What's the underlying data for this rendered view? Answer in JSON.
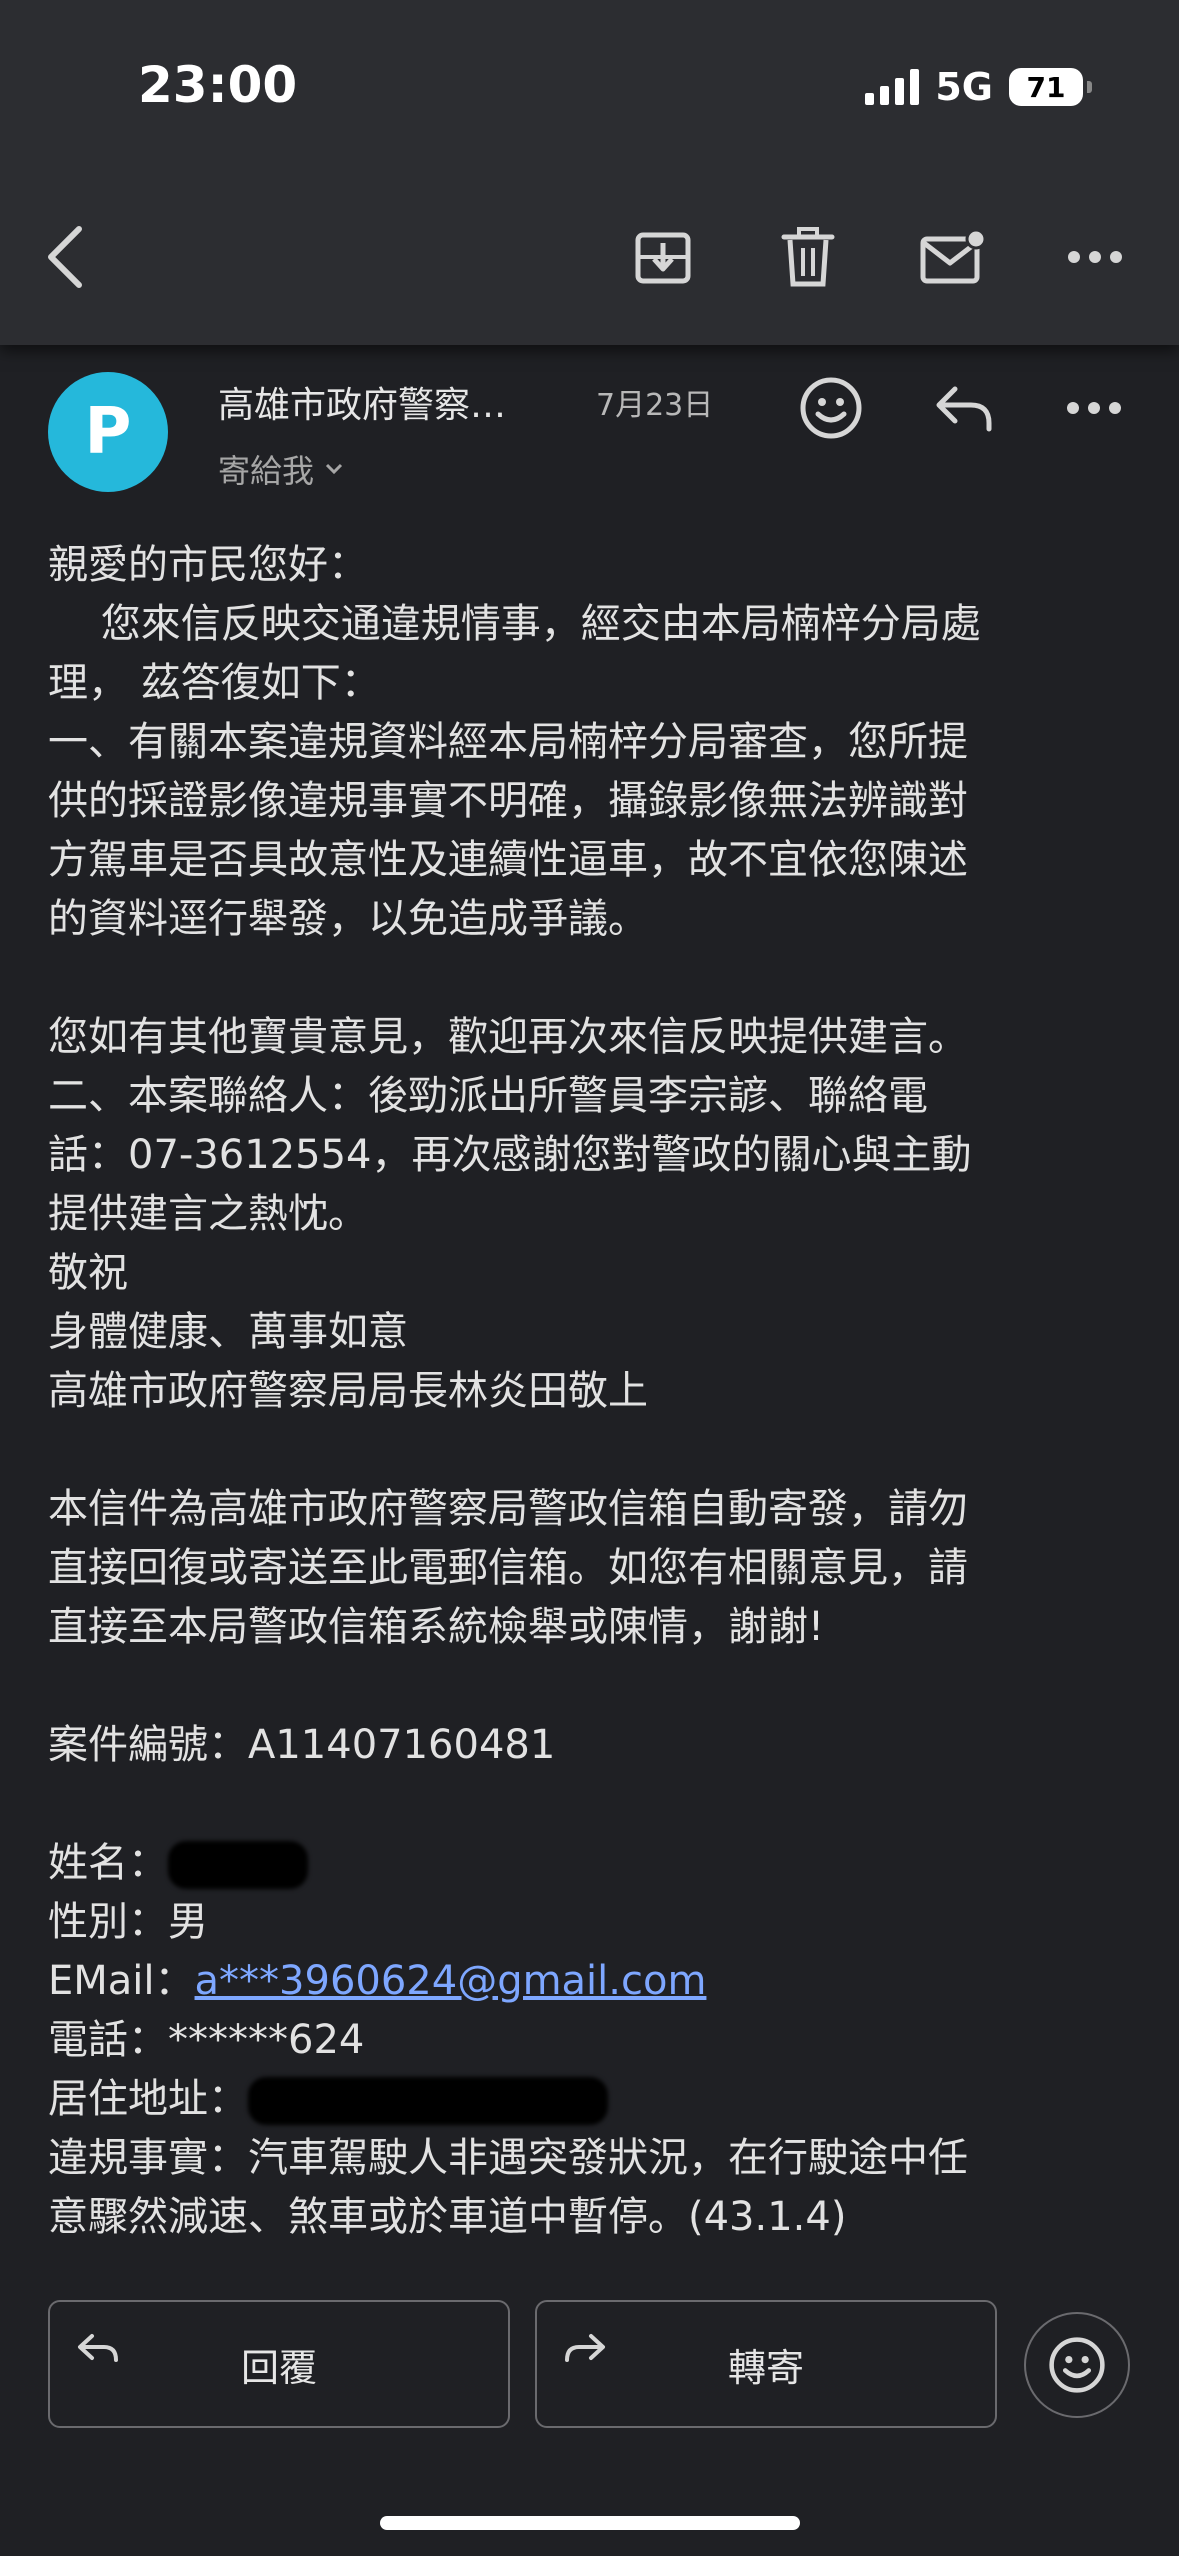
{
  "status_bar": {
    "time": "23:00",
    "network": "5G",
    "battery": "71"
  },
  "toolbar": {
    "back_icon": "chevron-left-icon",
    "archive_icon": "archive-icon",
    "delete_icon": "trash-icon",
    "unread_icon": "mail-unread-icon",
    "more_icon": "more-horizontal-icon"
  },
  "message": {
    "avatar_letter": "P",
    "sender": "高雄市政府警察…",
    "date": "7月23日",
    "recipient": "寄給我",
    "body_lines": [
      "親愛的市民您好：",
      "　 您來信反映交通違規情事，經交由本局楠梓分局處",
      "理， 茲答復如下：",
      "一、有關本案違規資料經本局楠梓分局審查，您所提",
      "供的採證影像違規事實不明確，攝錄影像無法辨識對",
      "方駕車是否具故意性及連續性逼車，故不宜依您陳述",
      "的資料逕行舉發，以免造成爭議。",
      "",
      "您如有其他寶貴意見，歡迎再次來信反映提供建言。",
      "二、本案聯絡人：後勁派出所警員李宗諺、聯絡電",
      "話：07-3612554，再次感謝您對警政的關心與主動",
      "提供建言之熱忱。",
      "敬祝",
      "身體健康、萬事如意",
      "高雄市政府警察局局長林炎田敬上",
      "",
      "本信件為高雄市政府警察局警政信箱自動寄發，請勿",
      "直接回復或寄送至此電郵信箱。如您有相關意見，請",
      "直接至本局警政信箱系統檢舉或陳情，謝謝!"
    ],
    "case_number": "案件編號：A11407160481",
    "name_label": "姓名：",
    "gender": "性別：男",
    "email_label": "EMail：",
    "email_value": "a***3960624@gmail.com",
    "phone": "電話：******624",
    "address_label": "居住地址：",
    "violation_lines": [
      "違規事實：汽車駕駛人非遇突發狀況，在行駛途中任",
      "意驟然減速、煞車或於車道中暫停。(43.1.4)"
    ]
  },
  "actions": {
    "reply": "回覆",
    "forward": "轉寄"
  },
  "colors": {
    "background": "#1f2024",
    "toolbar": "#2c2d31",
    "avatar": "#25b8db",
    "link": "#7ea7ff"
  }
}
